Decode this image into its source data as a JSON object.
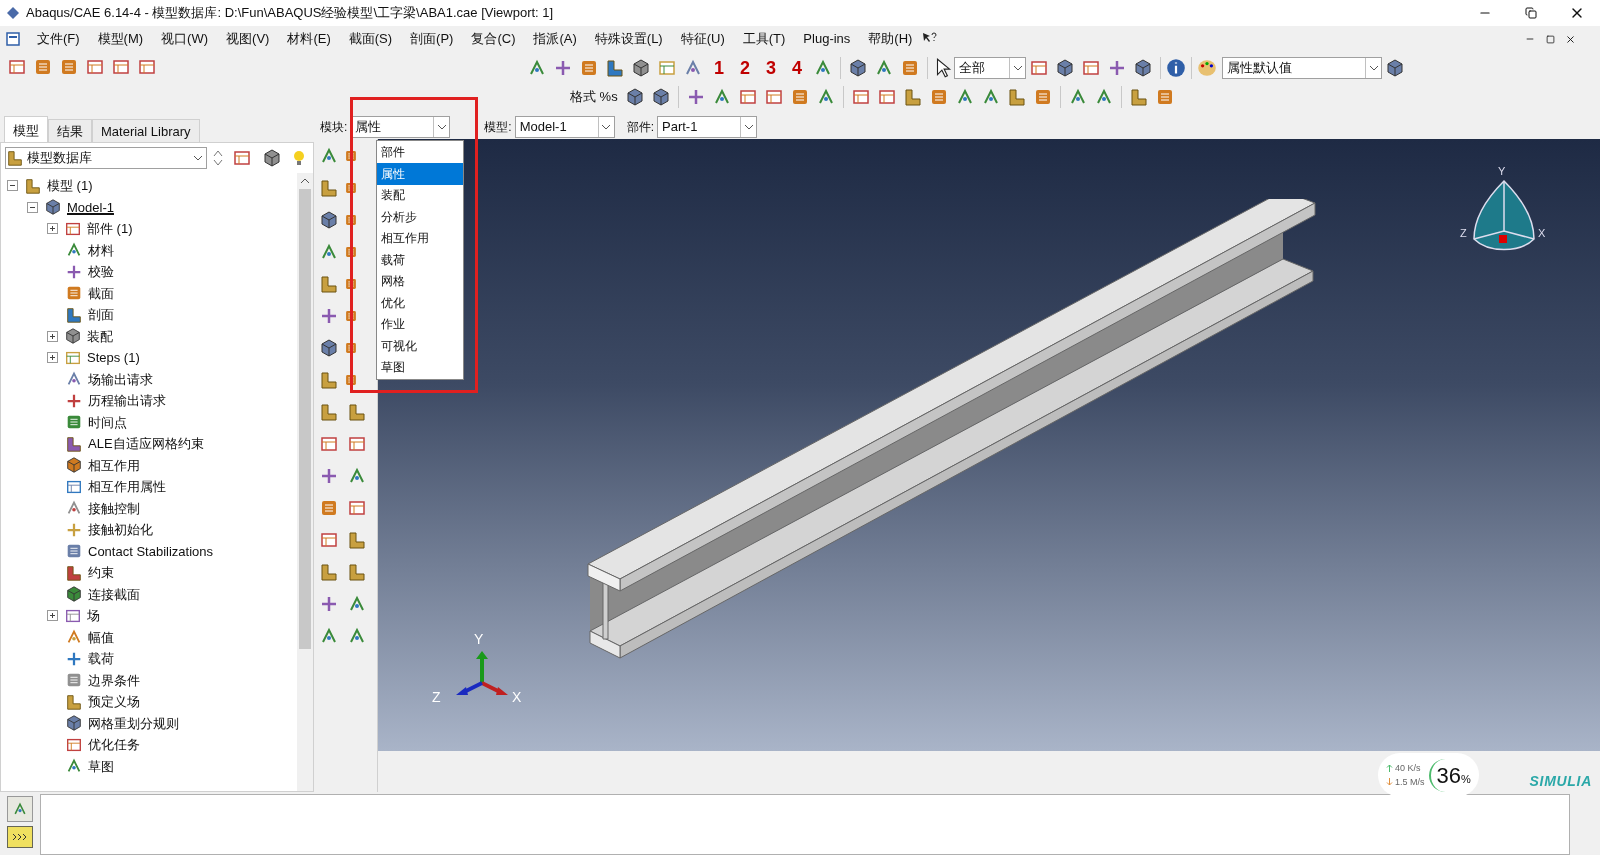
{
  "window": {
    "title": "Abaqus/CAE 6.14-4 - 模型数据库: D:\\Fun\\ABAQUS经验模型\\工字梁\\ABA1.cae [Viewport: 1]"
  },
  "menu": [
    "文件(F)",
    "模型(M)",
    "视口(W)",
    "视图(V)",
    "材料(E)",
    "截面(S)",
    "剖面(P)",
    "复合(C)",
    "指派(A)",
    "特殊设置(L)",
    "特征(U)",
    "工具(T)",
    "Plug-ins",
    "帮助(H)"
  ],
  "toolbar": {
    "view_numbers": [
      "1",
      "2",
      "3",
      "4"
    ],
    "format_button": "格式 %s",
    "selection_filter": "全部",
    "render_style": "属性默认值"
  },
  "left_tabs": [
    {
      "label": "模型",
      "selected": true
    },
    {
      "label": "结果",
      "selected": false
    },
    {
      "label": "Material Library",
      "selected": false
    }
  ],
  "tree_source": "模型数据库",
  "tree": [
    {
      "label": "模型 (1)",
      "expanded": true,
      "current": false,
      "children": [
        {
          "label": "Model-1",
          "expanded": true,
          "current": true,
          "children": [
            {
              "label": "部件 (1)",
              "expanded": false
            },
            {
              "label": "材料"
            },
            {
              "label": "校验"
            },
            {
              "label": "截面"
            },
            {
              "label": "剖面"
            },
            {
              "label": "装配",
              "expanded": false
            },
            {
              "label": "Steps (1)",
              "expanded": false
            },
            {
              "label": "场输出请求"
            },
            {
              "label": "历程输出请求"
            },
            {
              "label": "时间点"
            },
            {
              "label": "ALE自适应网格约束"
            },
            {
              "label": "相互作用"
            },
            {
              "label": "相互作用属性"
            },
            {
              "label": "接触控制"
            },
            {
              "label": "接触初始化"
            },
            {
              "label": "Contact Stabilizations"
            },
            {
              "label": "约束"
            },
            {
              "label": "连接截面"
            },
            {
              "label": "场",
              "expanded": false
            },
            {
              "label": "幅值"
            },
            {
              "label": "载荷"
            },
            {
              "label": "边界条件"
            },
            {
              "label": "预定义场"
            },
            {
              "label": "网格重划分规则"
            },
            {
              "label": "优化任务"
            },
            {
              "label": "草图"
            }
          ]
        }
      ]
    }
  ],
  "context_bar": [
    {
      "label": "模块:",
      "value": "属性"
    },
    {
      "label": "模型:",
      "value": "Model-1"
    },
    {
      "label": "部件:",
      "value": "Part-1"
    }
  ],
  "module_menu": [
    {
      "label": "部件",
      "selected": false
    },
    {
      "label": "属性",
      "selected": true
    },
    {
      "label": "装配",
      "selected": false
    },
    {
      "label": "分析步",
      "selected": false
    },
    {
      "label": "相互作用",
      "selected": false
    },
    {
      "label": "载荷",
      "selected": false
    },
    {
      "label": "网格",
      "selected": false
    },
    {
      "label": "优化",
      "selected": false
    },
    {
      "label": "作业",
      "selected": false
    },
    {
      "label": "可视化",
      "selected": false
    },
    {
      "label": "草图",
      "selected": false
    }
  ],
  "viewport": {
    "triad": {
      "y": "Y",
      "z": "Z",
      "x": "X"
    },
    "view_cube": {
      "y": "Y",
      "z": "Z",
      "x": "X"
    }
  },
  "network_widget": {
    "upload": "40 K/s",
    "download": "1.5 M/s",
    "percent": "36",
    "percent_sign": "%"
  },
  "brand": "SIMULIA"
}
